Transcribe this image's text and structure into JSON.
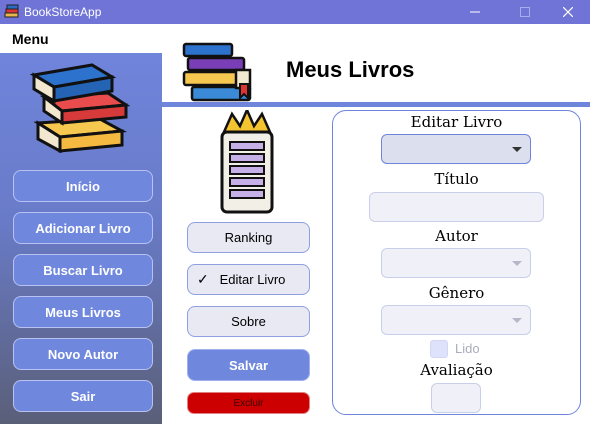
{
  "window": {
    "title": "BookStoreApp",
    "icon": "books-icon",
    "controls": {
      "minimize": "minimize-icon",
      "maximize": "maximize-icon",
      "close": "close-icon"
    }
  },
  "menubar": {
    "label": "Menu"
  },
  "sidebar": {
    "logo": "books-stack-icon",
    "items": [
      {
        "label": "Início"
      },
      {
        "label": "Adicionar Livro"
      },
      {
        "label": "Buscar Livro"
      },
      {
        "label": "Meus Livros"
      },
      {
        "label": "Novo Autor"
      },
      {
        "label": "Sair"
      }
    ]
  },
  "header": {
    "title": "Meus Livros",
    "icon": "bookshelf-icon"
  },
  "middle": {
    "icon": "crowned-ranking-list-icon",
    "buttons": {
      "ranking": "Ranking",
      "edit": "Editar Livro",
      "edit_checkmark": "✓",
      "about": "Sobre",
      "save": "Salvar",
      "delete": "Excluir"
    }
  },
  "edit_panel": {
    "edit_book_label": "Editar Livro",
    "title_label": "Título",
    "author_label": "Autor",
    "genre_label": "Gênero",
    "read_label": "Lido",
    "rating_label": "Avaliação",
    "title_value": "",
    "read_checked": false
  },
  "colors": {
    "accent": "#6f84db",
    "titlebar": "#6f74d6",
    "delete": "#cc0000"
  }
}
